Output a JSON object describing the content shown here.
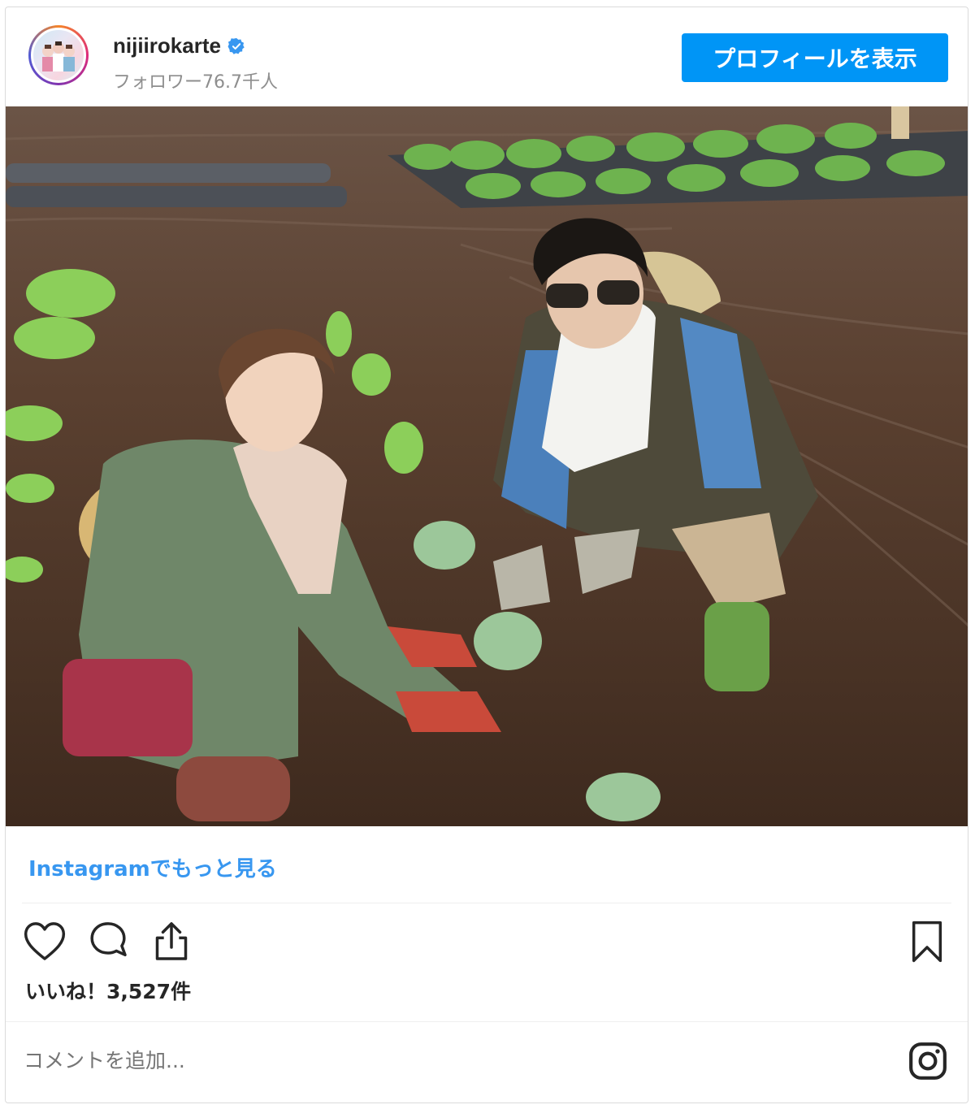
{
  "post": {
    "username": "nijiirokarte",
    "followers": "フォロワー76.7千人",
    "profile_button": "プロフィールを表示",
    "more_link": "Instagramでもっと見る",
    "likes": "いいね！3,527件",
    "comment_placeholder": "コメントを追加..."
  },
  "icons": {
    "verified": "verified-badge-icon",
    "like": "heart-icon",
    "comment": "comment-bubble-icon",
    "share": "share-icon",
    "save": "bookmark-icon",
    "instagram": "instagram-logo-icon"
  },
  "colors": {
    "accent": "#0095f6",
    "link": "#3897f0",
    "secondary_text": "#8e8e8e"
  }
}
